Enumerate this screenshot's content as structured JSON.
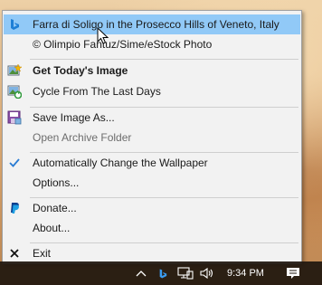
{
  "menu": {
    "items": [
      {
        "label": "Farra di Soligo in the Prosecco Hills of Veneto, Italy",
        "icon": "bing-icon"
      },
      {
        "label": "© Olimpio Fantuz/Sime/eStock Photo",
        "icon": ""
      },
      {
        "label": "Get Today's Image",
        "icon": "image-star-icon"
      },
      {
        "label": "Cycle From The Last Days",
        "icon": "image-cycle-icon"
      },
      {
        "label": "Save Image As...",
        "icon": "save-image-icon"
      },
      {
        "label": "Open Archive Folder",
        "icon": ""
      },
      {
        "label": "Automatically Change the Wallpaper",
        "icon": "checkmark-icon"
      },
      {
        "label": "Options...",
        "icon": ""
      },
      {
        "label": "Donate...",
        "icon": "paypal-icon"
      },
      {
        "label": "About...",
        "icon": ""
      },
      {
        "label": "Exit",
        "icon": "close-icon"
      }
    ]
  },
  "taskbar": {
    "clock": "9:34 PM",
    "tray_icons": [
      "chevron-up-icon",
      "bing-icon",
      "network-icon",
      "volume-icon",
      "notification-icon"
    ]
  },
  "colors": {
    "menu_bg": "#f2f2f2",
    "highlight": "#91c9f7",
    "bing_blue": "#1e7fd6",
    "check_blue": "#2a7cd3",
    "taskbar": "#1e160e"
  }
}
